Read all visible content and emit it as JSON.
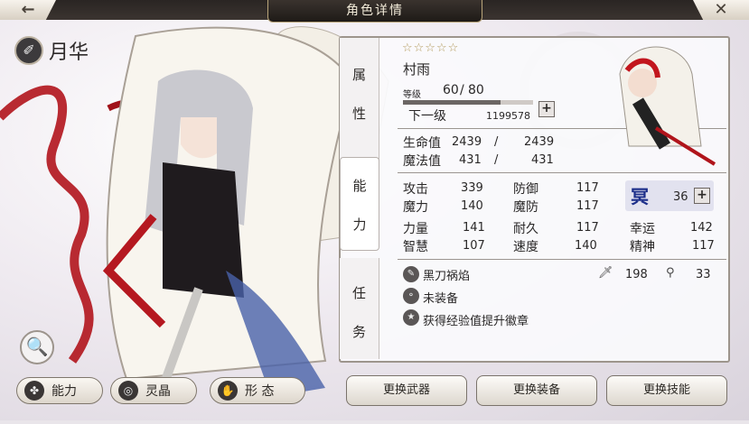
{
  "window": {
    "title": "角色详情",
    "back_icon": "←",
    "close_icon": "✕"
  },
  "character": {
    "name": "月华",
    "name_icon": "✐"
  },
  "search_icon": "🔍",
  "bottom_tabs": [
    {
      "label": "能力",
      "icon": "✤"
    },
    {
      "label": "灵晶",
      "icon": "◎"
    },
    {
      "label": "形 态",
      "icon": "✋"
    }
  ],
  "side_tabs": [
    {
      "label_1": "属",
      "label_2": "性"
    },
    {
      "label_1": "能",
      "label_2": "力"
    },
    {
      "label_1": "任",
      "label_2": "务"
    }
  ],
  "info": {
    "stars": "☆☆☆☆☆",
    "weapon_name": "村雨",
    "level_label": "等级",
    "level_current": "60",
    "level_sep": "/",
    "level_max": "80",
    "level_progress": 0.75,
    "next_level_label": "下一级",
    "next_level_exp": "1199578",
    "plus": "+"
  },
  "vitals": [
    {
      "label": "生命值",
      "value": "2439",
      "sep": "/",
      "max": "2439"
    },
    {
      "label": "魔法值",
      "value": "431",
      "sep": "/",
      "max": "431"
    }
  ],
  "stats": {
    "attack_label": "攻击",
    "attack": "339",
    "defense_label": "防御",
    "defense": "117",
    "magic_label": "魔力",
    "magic": "140",
    "mdef_label": "魔防",
    "mdef": "117",
    "power_label": "力量",
    "power": "141",
    "endure_label": "耐久",
    "endure": "117",
    "luck_label": "幸运",
    "luck": "142",
    "wisdom_label": "智慧",
    "wisdom": "107",
    "speed_label": "速度",
    "speed": "140",
    "spirit_label": "精神",
    "spirit": "117",
    "rank_glyph": "冥",
    "rank_points": "36"
  },
  "skills": {
    "skill_name": "黑刀祸焰",
    "skill_val_1": "198",
    "skill_val_2": "33",
    "equip_label": "未装备",
    "badge_label": "获得经验值提升徽章"
  },
  "actions": [
    "更换武器",
    "更换装备",
    "更换技能"
  ]
}
